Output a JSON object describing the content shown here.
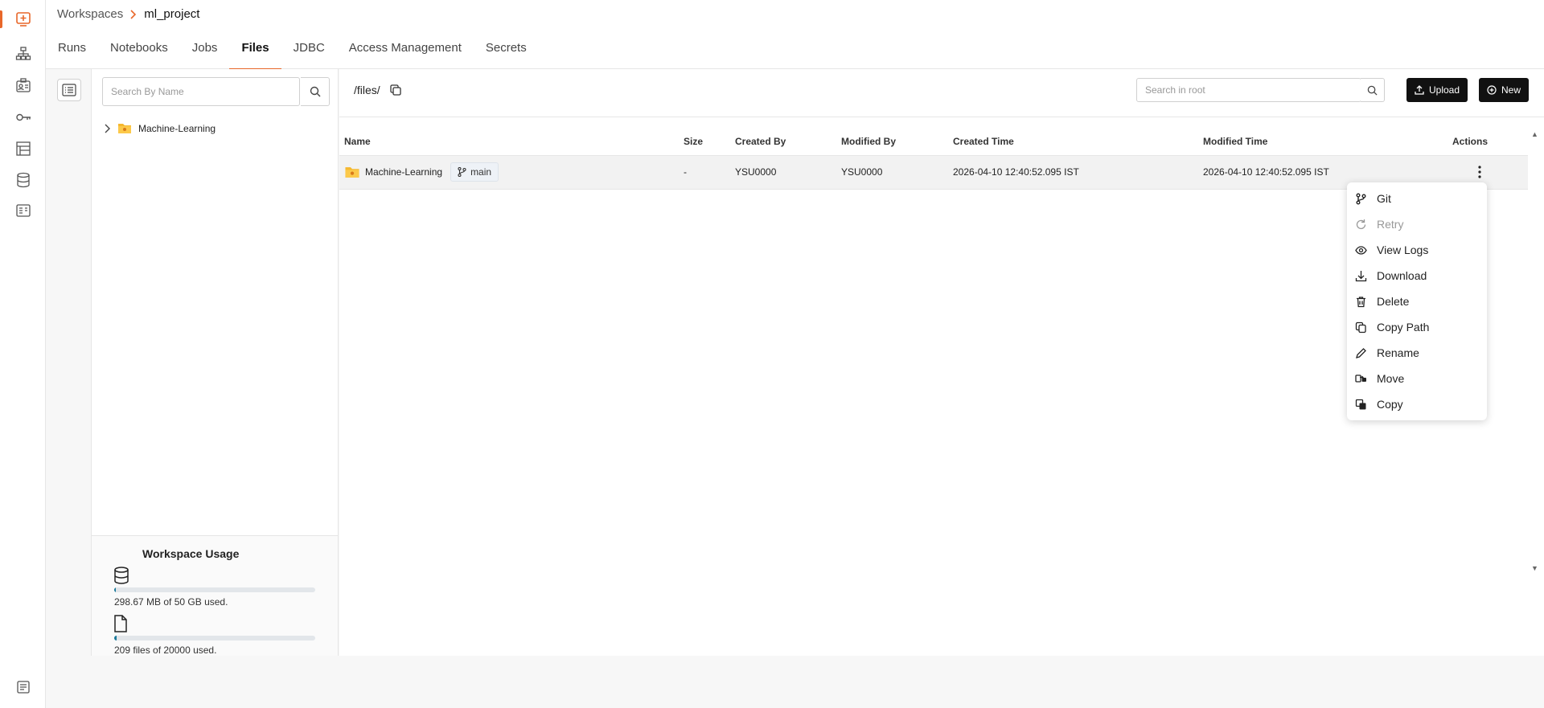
{
  "breadcrumb": {
    "root": "Workspaces",
    "current": "ml_project"
  },
  "tabs": [
    {
      "label": "Runs",
      "active": false
    },
    {
      "label": "Notebooks",
      "active": false
    },
    {
      "label": "Jobs",
      "active": false
    },
    {
      "label": "Files",
      "active": true
    },
    {
      "label": "JDBC",
      "active": false
    },
    {
      "label": "Access Management",
      "active": false
    },
    {
      "label": "Secrets",
      "active": false
    }
  ],
  "rail": {
    "icons": [
      "workspace-icon",
      "sitemap-icon",
      "id-card-icon",
      "key-icon",
      "boards-icon",
      "database-icon",
      "receipt-icon",
      "docs-icon"
    ],
    "accent": "#e8672a"
  },
  "tree": {
    "search_placeholder": "Search By Name",
    "items": [
      {
        "label": "Machine-Learning"
      }
    ]
  },
  "usage": {
    "title": "Workspace Usage",
    "storage_text": "298.67 MB of 50 GB used.",
    "storage_fraction": 0.006,
    "files_text": "209 files of 20000 used.",
    "files_fraction": 0.0105
  },
  "files": {
    "path": "/files/",
    "search_placeholder": "Search in root",
    "upload_label": "Upload",
    "new_label": "New",
    "columns": [
      "Name",
      "Size",
      "Created By",
      "Modified By",
      "Created Time",
      "Modified Time",
      "Actions"
    ],
    "rows": [
      {
        "name": "Machine-Learning",
        "branch": "main",
        "size": "-",
        "created_by": "YSU0000",
        "modified_by": "YSU0000",
        "created_time": "2026-04-10 12:40:52.095 IST",
        "modified_time": "2026-04-10 12:40:52.095 IST"
      }
    ]
  },
  "menu": {
    "items": [
      {
        "label": "Git",
        "icon": "git-branch-icon",
        "disabled": false
      },
      {
        "label": "Retry",
        "icon": "retry-icon",
        "disabled": true
      },
      {
        "label": "View Logs",
        "icon": "eye-icon",
        "disabled": false
      },
      {
        "label": "Download",
        "icon": "download-icon",
        "disabled": false
      },
      {
        "label": "Delete",
        "icon": "trash-icon",
        "disabled": false
      },
      {
        "label": "Copy Path",
        "icon": "copy-path-icon",
        "disabled": false
      },
      {
        "label": "Rename",
        "icon": "pencil-icon",
        "disabled": false
      },
      {
        "label": "Move",
        "icon": "move-icon",
        "disabled": false
      },
      {
        "label": "Copy",
        "icon": "copy-icon",
        "disabled": false
      }
    ]
  }
}
